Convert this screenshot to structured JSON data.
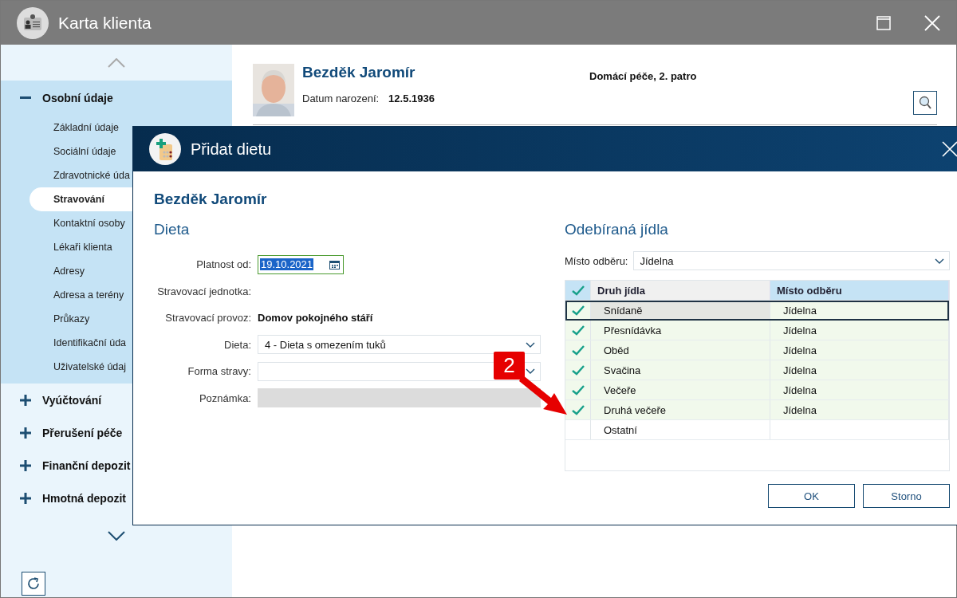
{
  "window": {
    "title": "Karta klienta"
  },
  "sidebar": {
    "sections": [
      {
        "label": "Osobní údaje",
        "expanded": true,
        "children": [
          {
            "label": "Základní údaje",
            "selected": false
          },
          {
            "label": "Sociální údaje",
            "selected": false
          },
          {
            "label": "Zdravotnické úda",
            "selected": false
          },
          {
            "label": "Stravování",
            "selected": true
          },
          {
            "label": "Kontaktní osoby",
            "selected": false
          },
          {
            "label": "Lékaři klienta",
            "selected": false
          },
          {
            "label": "Adresy",
            "selected": false
          },
          {
            "label": "Adresa a terény",
            "selected": false
          },
          {
            "label": "Průkazy",
            "selected": false
          },
          {
            "label": "Identifikační úda",
            "selected": false
          },
          {
            "label": "Uživatelské údaj",
            "selected": false
          }
        ]
      },
      {
        "label": "Vyúčtování",
        "expanded": false
      },
      {
        "label": "Přerušení péče",
        "expanded": false
      },
      {
        "label": "Finanční depozit",
        "expanded": false
      },
      {
        "label": "Hmotná depozit",
        "expanded": false
      }
    ]
  },
  "client": {
    "name": "Bezděk Jaromír",
    "birth_label": "Datum narození:",
    "birth_date": "12.5.1936",
    "location": "Domácí péče, 2. patro"
  },
  "dialog": {
    "title": "Přidat dietu",
    "client_name": "Bezděk Jaromír",
    "diet": {
      "heading": "Dieta",
      "rows": [
        {
          "kind": "date",
          "label": "Platnost od:",
          "value": "19.10.2021",
          "text_selected": true
        },
        {
          "kind": "text",
          "label": "Stravovací jednotka:"
        },
        {
          "kind": "text",
          "label": "Stravovací provoz:",
          "value": "Domov pokojného stáří"
        },
        {
          "kind": "select",
          "label": "Dieta:",
          "value": "4 - Dieta s omezením tuků"
        },
        {
          "kind": "select",
          "label": "Forma stravy:"
        },
        {
          "kind": "disabled",
          "label": "Poznámka:"
        }
      ]
    },
    "meals": {
      "heading": "Odebíraná jídla",
      "place_label": "Místo odběru:",
      "place_value": "Jídelna",
      "table": {
        "header_checked": true,
        "columns": [
          "Druh jídla",
          "Místo odběru"
        ],
        "rows": [
          {
            "checked": true,
            "selected": true,
            "meal": "Snídaně",
            "place": "Jídelna"
          },
          {
            "checked": true,
            "selected": false,
            "meal": "Přesnídávka",
            "place": "Jídelna"
          },
          {
            "checked": true,
            "selected": false,
            "meal": "Oběd",
            "place": "Jídelna"
          },
          {
            "checked": true,
            "selected": false,
            "meal": "Svačina",
            "place": "Jídelna"
          },
          {
            "checked": true,
            "selected": false,
            "meal": "Večeře",
            "place": "Jídelna"
          },
          {
            "checked": true,
            "selected": false,
            "meal": "Druhá večeře",
            "place": "Jídelna"
          },
          {
            "checked": false,
            "selected": false,
            "meal": "Ostatní",
            "place": ""
          }
        ]
      }
    },
    "buttons": [
      "OK",
      "Storno"
    ]
  },
  "annotation": {
    "label": "2"
  }
}
